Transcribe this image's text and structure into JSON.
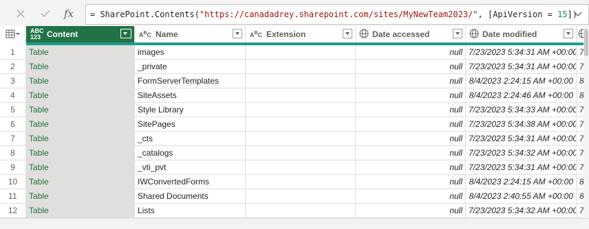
{
  "formula_bar": {
    "cancel_icon": "close-icon",
    "commit_icon": "check-icon",
    "fx_label": "fx",
    "formula_prefix": "= SharePoint.Contents(",
    "formula_url": "\"https://canadadrey.sharepoint.com/sites/MyNewTeam2023/\"",
    "formula_mid": ", [ApiVersion = ",
    "formula_num": "15",
    "formula_suffix": "])"
  },
  "columns": [
    {
      "label": "Content",
      "type": "ABC\n123",
      "selected": true
    },
    {
      "label": "Name",
      "type": "ABC"
    },
    {
      "label": "Extension",
      "type": "ABC"
    },
    {
      "label": "Date accessed",
      "type": "globe-icon"
    },
    {
      "label": "Date modified",
      "type": "globe-icon"
    }
  ],
  "rows": [
    {
      "n": "1",
      "content": "Table",
      "name": "images",
      "extension": "",
      "accessed": "null",
      "modified": "7/23/2023 5:34:31 AM +00:00",
      "extra": "7/"
    },
    {
      "n": "2",
      "content": "Table",
      "name": "_private",
      "extension": "",
      "accessed": "null",
      "modified": "7/23/2023 5:34:31 AM +00:00",
      "extra": "7/"
    },
    {
      "n": "3",
      "content": "Table",
      "name": "FormServerTemplates",
      "extension": "",
      "accessed": "null",
      "modified": "8/4/2023 2:24:15 AM +00:00",
      "extra": "8"
    },
    {
      "n": "4",
      "content": "Table",
      "name": "SiteAssets",
      "extension": "",
      "accessed": "null",
      "modified": "8/4/2023 2:24:46 AM +00:00",
      "extra": "8"
    },
    {
      "n": "5",
      "content": "Table",
      "name": "Style Library",
      "extension": "",
      "accessed": "null",
      "modified": "7/23/2023 5:34:33 AM +00:00",
      "extra": "7/"
    },
    {
      "n": "6",
      "content": "Table",
      "name": "SitePages",
      "extension": "",
      "accessed": "null",
      "modified": "7/23/2023 5:34:38 AM +00:00",
      "extra": "7/"
    },
    {
      "n": "7",
      "content": "Table",
      "name": "_cts",
      "extension": "",
      "accessed": "null",
      "modified": "7/23/2023 5:34:31 AM +00:00",
      "extra": "7/"
    },
    {
      "n": "8",
      "content": "Table",
      "name": "_catalogs",
      "extension": "",
      "accessed": "null",
      "modified": "7/23/2023 5:34:32 AM +00:00",
      "extra": "7/"
    },
    {
      "n": "9",
      "content": "Table",
      "name": "_vti_pvt",
      "extension": "",
      "accessed": "null",
      "modified": "7/23/2023 5:34:31 AM +00:00",
      "extra": "7/"
    },
    {
      "n": "10",
      "content": "Table",
      "name": "IWConvertedForms",
      "extension": "",
      "accessed": "null",
      "modified": "8/4/2023 2:24:15 AM +00:00",
      "extra": "8"
    },
    {
      "n": "11",
      "content": "Table",
      "name": "Shared Documents",
      "extension": "",
      "accessed": "null",
      "modified": "8/4/2023 2:40:55 AM +00:00",
      "extra": "8"
    },
    {
      "n": "12",
      "content": "Table",
      "name": "Lists",
      "extension": "",
      "accessed": "null",
      "modified": "7/23/2023 5:34:32 AM +00:00",
      "extra": "7/"
    }
  ],
  "colors": {
    "selected_header": "#217346",
    "quality_bar": "#1a9e8f",
    "table_link": "#217346"
  }
}
